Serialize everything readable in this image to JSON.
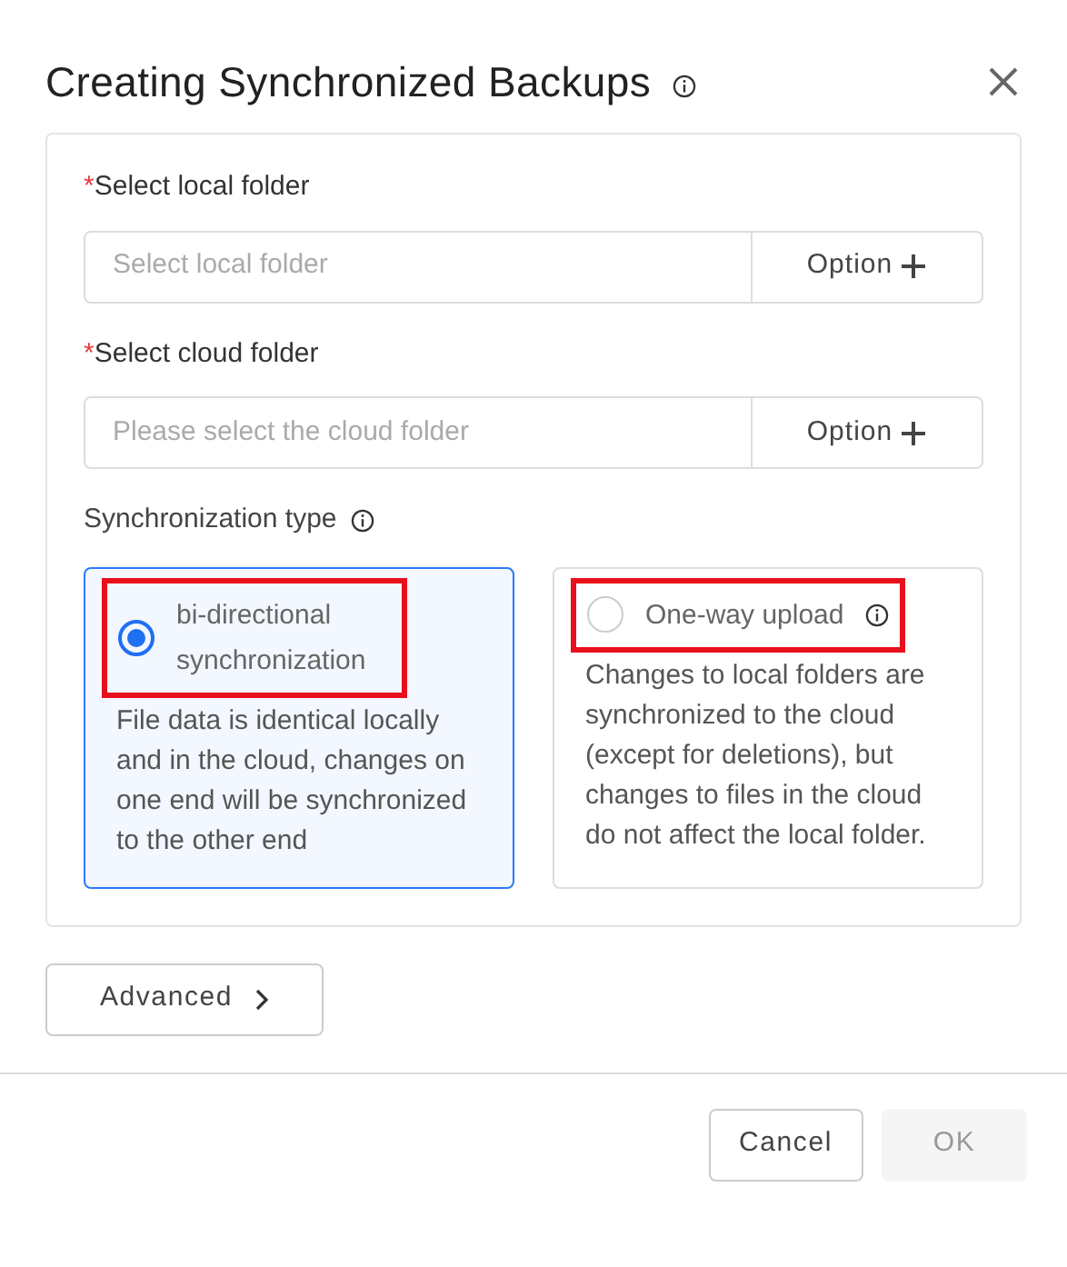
{
  "dialog": {
    "title": "Creating Synchronized Backups"
  },
  "fields": [
    {
      "required_mark": "*",
      "label": "Select local folder",
      "placeholder": "Select local folder",
      "option": "Option"
    },
    {
      "required_mark": "*",
      "label": "Select cloud folder",
      "placeholder": "Please select the cloud folder",
      "option": "Option"
    }
  ],
  "sync_type": {
    "label": "Synchronization type",
    "options": [
      {
        "title": "bi-directional synchronization",
        "description": "File data is identical locally and in the cloud, changes on one end will be synchronized to the other end",
        "selected": true,
        "highlighted": true,
        "info": false
      },
      {
        "title": "One-way upload",
        "description": "Changes to local folders are synchronized to the cloud (except for deletions), but changes to files in the cloud do not affect the local folder.",
        "selected": false,
        "highlighted": true,
        "info": true
      }
    ]
  },
  "advanced": "Advanced",
  "buttons": [
    {
      "label": "Cancel",
      "disabled": false
    },
    {
      "label": "OK",
      "disabled": true
    }
  ]
}
